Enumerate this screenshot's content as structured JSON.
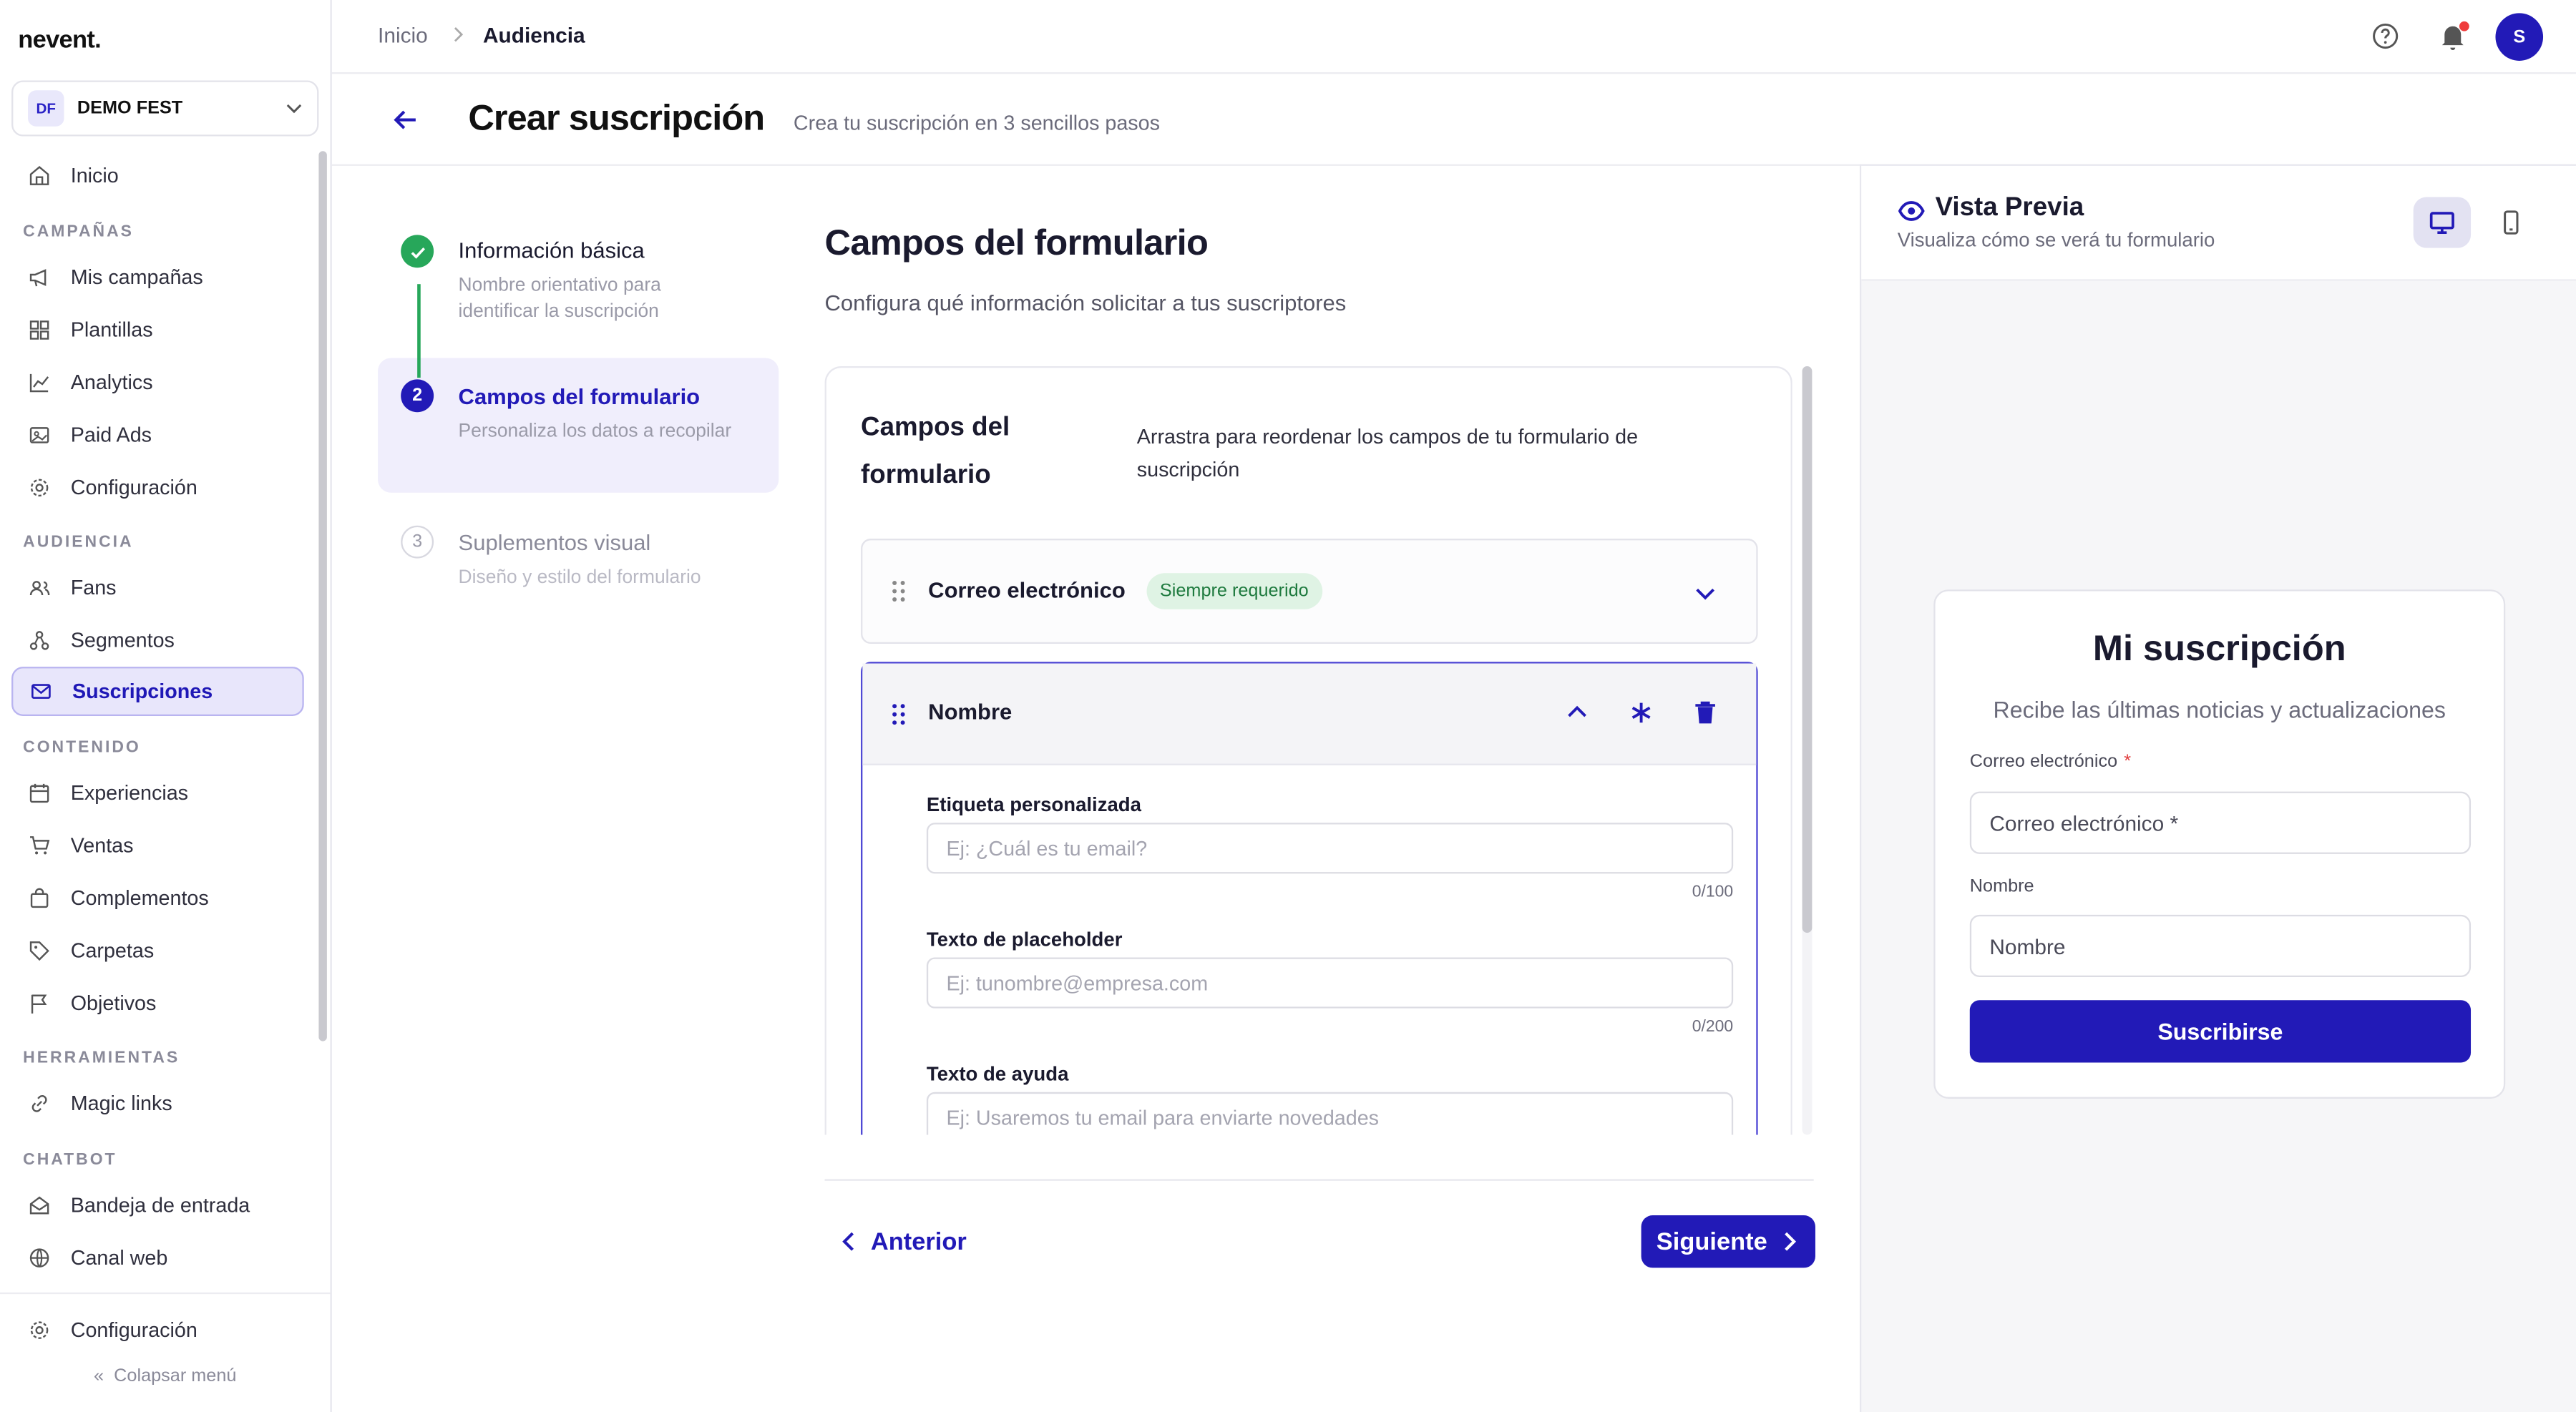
{
  "app": {
    "logo": "nevent."
  },
  "org": {
    "initials": "DF",
    "name": "DEMO FEST"
  },
  "sidebar": {
    "home": "Inicio",
    "sections": {
      "campaigns": "CAMPAÑAS",
      "audience": "AUDIENCIA",
      "content": "CONTENIDO",
      "tools": "HERRAMIENTAS",
      "chatbot": "CHATBOT"
    },
    "items": {
      "my_campaigns": "Mis campañas",
      "templates": "Plantillas",
      "analytics": "Analytics",
      "paid_ads": "Paid Ads",
      "config_campaigns": "Configuración",
      "fans": "Fans",
      "segments": "Segmentos",
      "subscriptions": "Suscripciones",
      "experiences": "Experiencias",
      "sales": "Ventas",
      "addons": "Complementos",
      "folders": "Carpetas",
      "goals": "Objetivos",
      "magic_links": "Magic links",
      "inbox": "Bandeja de entrada",
      "web_channel": "Canal web"
    },
    "settings": "Configuración",
    "collapse": "Colapsar menú"
  },
  "breadcrumb": {
    "home": "Inicio",
    "current": "Audiencia"
  },
  "user": {
    "initial": "S"
  },
  "header": {
    "title": "Crear suscripción",
    "subtitle": "Crea tu suscripción en 3 sencillos pasos"
  },
  "steps": [
    {
      "number": "1",
      "title": "Información básica",
      "desc": "Nombre orientativo para identificar la suscripción",
      "state": "done"
    },
    {
      "number": "2",
      "title": "Campos del formulario",
      "desc": "Personaliza los datos a recopilar",
      "state": "active"
    },
    {
      "number": "3",
      "title": "Suplementos visual",
      "desc": "Diseño y estilo del formulario",
      "state": "pending"
    }
  ],
  "main": {
    "title": "Campos del formulario",
    "subtitle": "Configura qué información solicitar a tus suscriptores",
    "card_title": "Campos del formulario",
    "card_desc": "Arrastra para reordenar los campos de tu formulario de suscripción",
    "fields": [
      {
        "name": "Correo electrónico",
        "badge": "Siempre requerido"
      },
      {
        "name": "Nombre",
        "custom_label": {
          "label": "Etiqueta personalizada",
          "placeholder": "Ej: ¿Cuál es tu email?",
          "counter": "0/100"
        },
        "placeholder_text": {
          "label": "Texto de placeholder",
          "placeholder": "Ej: tunombre@empresa.com",
          "counter": "0/200"
        },
        "help_text": {
          "label": "Texto de ayuda",
          "placeholder": "Ej: Usaremos tu email para enviarte novedades"
        }
      }
    ]
  },
  "footer": {
    "prev": "Anterior",
    "next": "Siguiente"
  },
  "preview": {
    "title": "Vista Previa",
    "subtitle": "Visualiza cómo se verá tu formulario",
    "form": {
      "title": "Mi suscripción",
      "subtitle": "Recibe las últimas noticias y actualizaciones",
      "email_label": "Correo electrónico",
      "required_mark": "*",
      "email_placeholder": "Correo electrónico *",
      "name_label": "Nombre",
      "name_placeholder": "Nombre",
      "submit": "Suscribirse"
    }
  },
  "colors": {
    "accent": "#221ab7",
    "success": "#27a75a",
    "badge_bg": "#dff3e4",
    "badge_text": "#1e7a3e",
    "notif": "#ef3b3b"
  }
}
